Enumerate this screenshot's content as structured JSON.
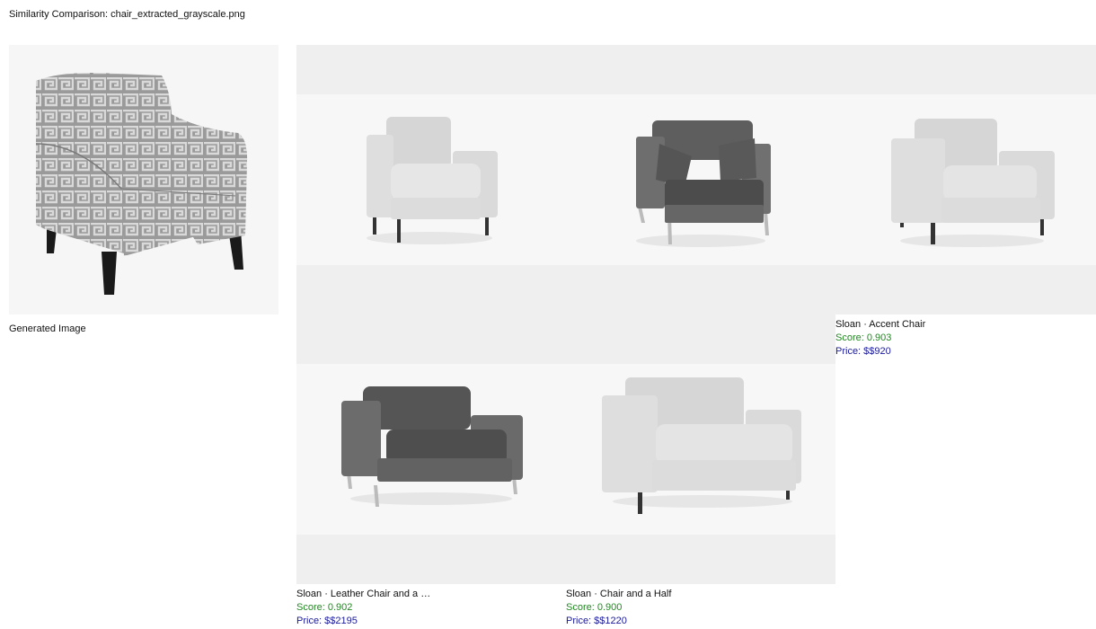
{
  "page": {
    "title": "Similarity Comparison: chair_extracted_grayscale.png"
  },
  "generated": {
    "caption": "Generated Image",
    "icon": "patterned-armchair-icon"
  },
  "results": [
    {
      "name": "",
      "score": "",
      "price": "",
      "icon": "light-armchair-icon"
    },
    {
      "name": "",
      "score": "",
      "price": "",
      "icon": "leather-armchair-icon"
    },
    {
      "name": "Sloan · Accent Chair",
      "score": "Score: 0.903",
      "price": "Price: $$920",
      "icon": "light-accent-chair-icon"
    },
    {
      "name": "Sloan · Leather Chair and a Ha...",
      "score": "Score: 0.902",
      "price": "Price: $$2195",
      "icon": "leather-chair-and-a-half-icon"
    },
    {
      "name": "Sloan · Chair and a Half",
      "score": "Score: 0.900",
      "price": "Price: $$1220",
      "icon": "light-chair-and-a-half-icon"
    }
  ],
  "colors": {
    "score": "#1f8a1f",
    "price": "#1a1a9a",
    "panel_band": "#efefef",
    "panel_bg": "#f7f7f7"
  }
}
